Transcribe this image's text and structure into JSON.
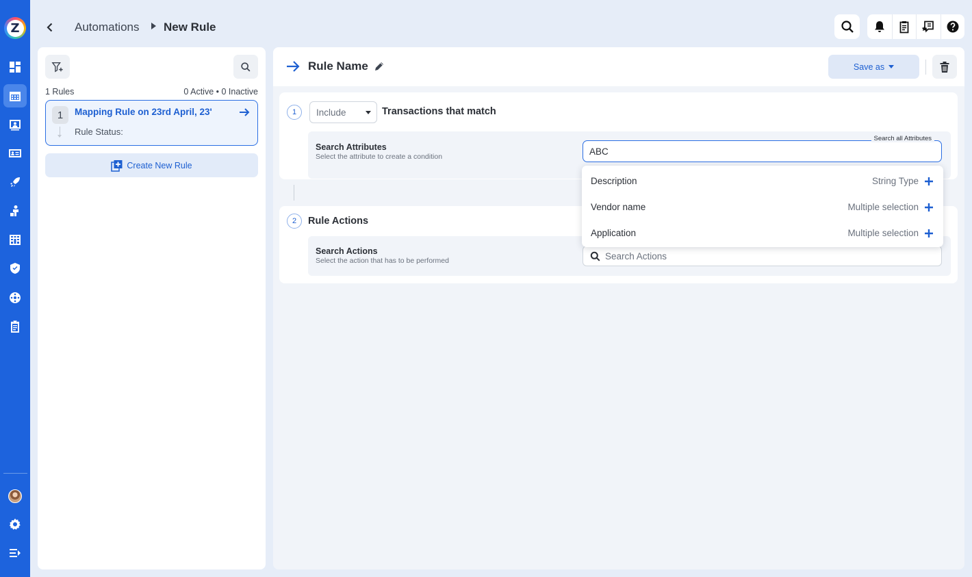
{
  "header": {
    "breadcrumb": [
      "Automations",
      "New Rule"
    ]
  },
  "sidebar": {
    "logo_letter": "Z",
    "icons": [
      "dashboard-icon",
      "calendar-icon",
      "contact-card-icon",
      "id-card-icon",
      "rocket-icon",
      "vendor-icon",
      "building-icon",
      "shield-check-icon",
      "network-icon",
      "clipboard-icon",
      "settings-icon",
      "collapse-menu-icon"
    ],
    "active_index": 1
  },
  "rules_panel": {
    "count": "1 Rules",
    "status": "0 Active • 0 Inactive",
    "rules": [
      {
        "number": "1",
        "title": "Mapping Rule on 23rd April, 23'",
        "status_label": "Rule Status:"
      }
    ],
    "create_label": "Create New Rule"
  },
  "editor": {
    "rule_name": "Rule Name",
    "save_label": "Save as",
    "condition": {
      "step": "1",
      "mode": "Include",
      "match_label": "Transactions that match",
      "attr_title": "Search Attributes",
      "attr_subtitle": "Select the attribute to create a condition",
      "input_label": "Search all Attributes",
      "input_value": "ABC"
    },
    "actions": {
      "step": "2",
      "label": "Rule Actions",
      "title": "Search Actions",
      "subtitle": "Select the action that has to be performed",
      "placeholder": "Search Actions"
    }
  },
  "dropdown": {
    "items": [
      {
        "name": "Description",
        "type": "String Type"
      },
      {
        "name": "Vendor name",
        "type": "Multiple selection"
      },
      {
        "name": "Application",
        "type": "Multiple selection"
      }
    ]
  },
  "colors": {
    "primary": "#1d63dd",
    "accent": "#1d5fd1",
    "background": "#e6edf8"
  }
}
